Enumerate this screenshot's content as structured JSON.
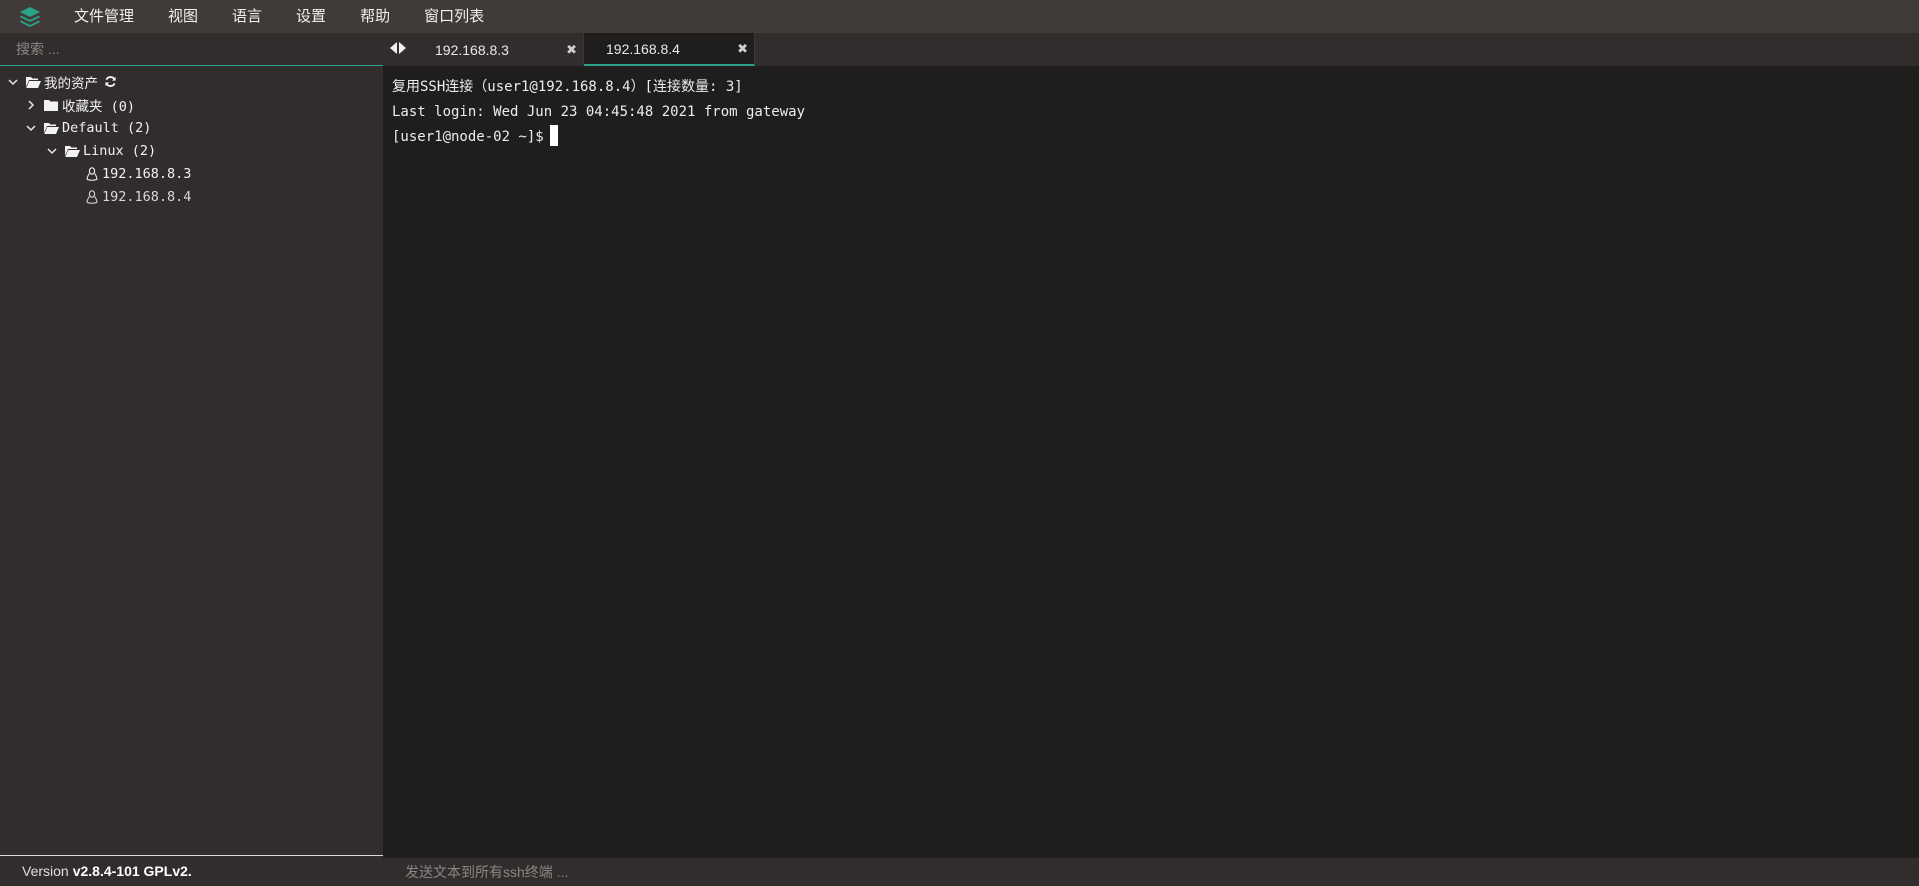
{
  "menubar": {
    "logo_icon": "layers-logo-icon",
    "items": [
      "文件管理",
      "视图",
      "语言",
      "设置",
      "帮助",
      "窗口列表"
    ]
  },
  "sidebar": {
    "search_placeholder": "搜索 ...",
    "tree": {
      "root": {
        "label": "我的资产",
        "icon": "folder-open-icon",
        "expanded": true
      },
      "favorites": {
        "label": "收藏夹 (0)",
        "icon": "folder-icon",
        "expanded": false
      },
      "default": {
        "label": "Default (2)",
        "icon": "folder-open-icon",
        "expanded": true
      },
      "linux": {
        "label": "Linux (2)",
        "icon": "folder-open-icon",
        "expanded": true
      },
      "hosts": [
        "192.168.8.3",
        "192.168.8.4"
      ]
    },
    "version_prefix": "Version",
    "version_value": "v2.8.4-101 GPLv2."
  },
  "tabs": [
    {
      "label": "192.168.8.3",
      "active": false,
      "close": "✖"
    },
    {
      "label": "192.168.8.4",
      "active": true,
      "close": "✖"
    }
  ],
  "terminal": {
    "lines": [
      "复用SSH连接（user1@192.168.8.4）[连接数量: 3]",
      "Last login: Wed Jun 23 04:45:48 2021 from gateway",
      "[user1@node-02 ~]$"
    ]
  },
  "broadcast": {
    "placeholder": "发送文本到所有ssh终端 ..."
  },
  "colors": {
    "accent": "#2aa38a",
    "menubar_bg": "#403a39",
    "sidebar_bg": "#302d2c",
    "terminal_bg": "#201e1d"
  }
}
